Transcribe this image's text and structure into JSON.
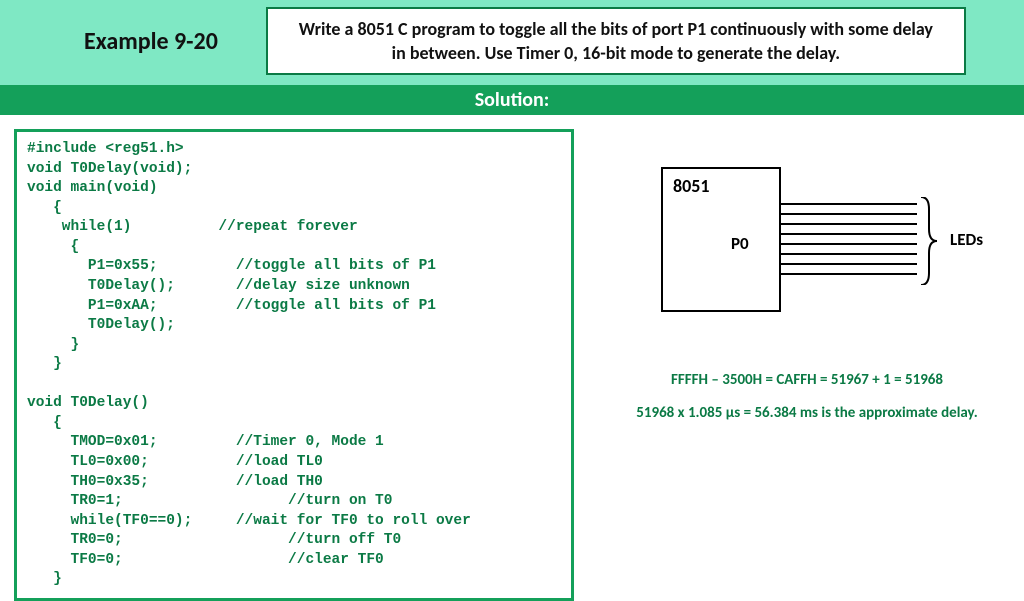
{
  "header": {
    "example": "Example 9-20",
    "prompt": "Write a 8051 C program to toggle all the bits of port P1 continuously with some delay in between.  Use Timer 0, 16-bit mode to generate the delay."
  },
  "solution_label": "Solution:",
  "code": "#include <reg51.h>\nvoid T0Delay(void);\nvoid main(void)\n   {\n    while(1)          //repeat forever\n     {\n       P1=0x55;         //toggle all bits of P1\n       T0Delay();       //delay size unknown\n       P1=0xAA;         //toggle all bits of P1\n       T0Delay();\n     }\n   }\n\nvoid T0Delay()\n   {\n     TMOD=0x01;         //Timer 0, Mode 1\n     TL0=0x00;          //load TL0\n     TH0=0x35;          //load TH0\n     TR0=1;                   //turn on T0\n     while(TF0==0);     //wait for TF0 to roll over\n     TR0=0;                   //turn off T0\n     TF0=0;                   //clear TF0\n   }",
  "diagram": {
    "chip": "8051",
    "port": "P0",
    "leds": "LEDs"
  },
  "calc": {
    "line1": "FFFFH – 3500H = CAFFH = 51967 + 1 = 51968",
    "line2": "51968 x 1.085 µs = 56.384 ms is the approximate delay."
  }
}
